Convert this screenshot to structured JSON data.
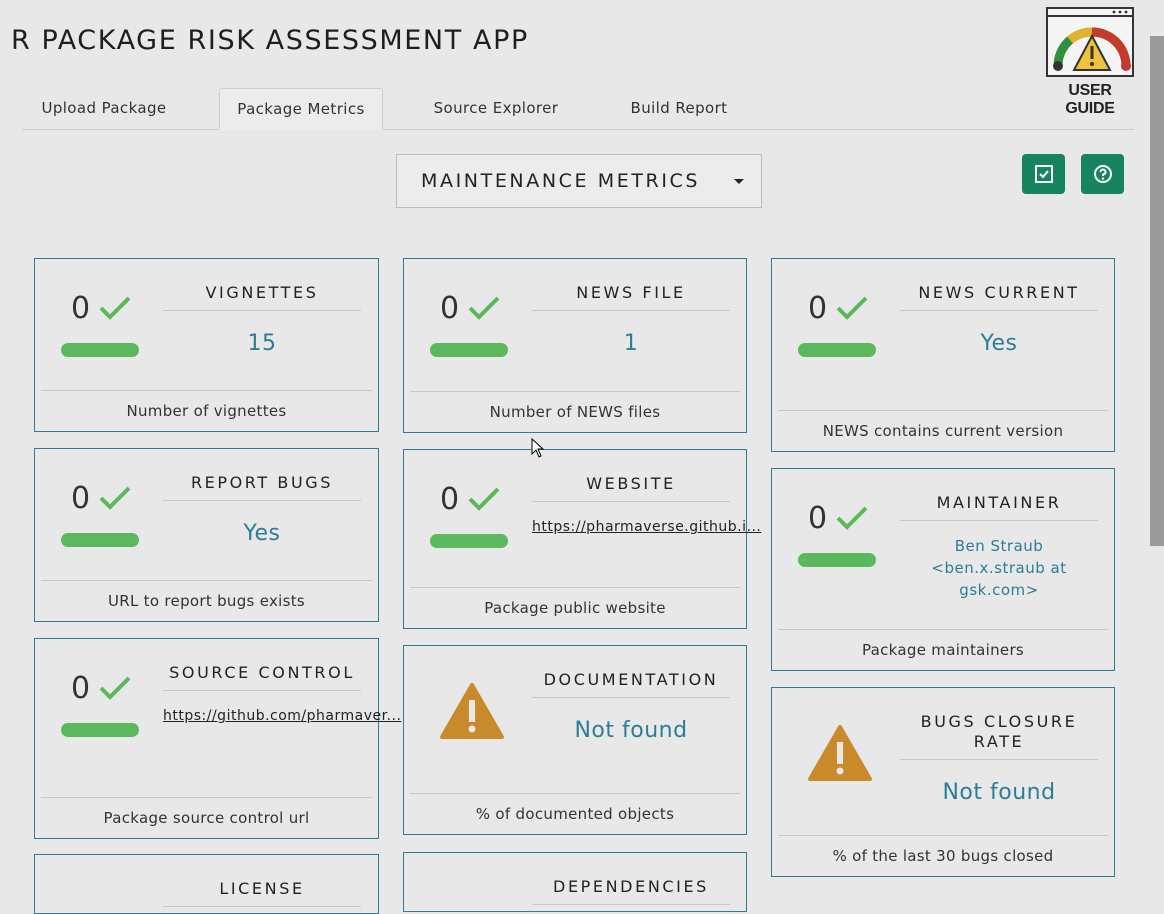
{
  "app": {
    "title": "R PACKAGE RISK ASSESSMENT APP"
  },
  "guide": {
    "label": "USER GUIDE"
  },
  "tabs": [
    {
      "label": "Upload Package"
    },
    {
      "label": "Package Metrics"
    },
    {
      "label": "Source Explorer"
    },
    {
      "label": "Build Report"
    }
  ],
  "toolbar": {
    "metric_category": "MAINTENANCE METRICS"
  },
  "colors": {
    "accent": "#2d7d96",
    "button": "#16855f",
    "bar": "#5cb85c",
    "warning": "#c98a2c"
  },
  "cards": [
    {
      "score": "0",
      "heading": "VIGNETTES",
      "value": "15",
      "footer": "Number of vignettes",
      "status": "check-icon"
    },
    {
      "score": "0",
      "heading": "NEWS FILE",
      "value": "1",
      "footer": "Number of NEWS files",
      "status": "check-icon"
    },
    {
      "score": "0",
      "heading": "NEWS CURRENT",
      "value": "Yes",
      "footer": "NEWS contains current version",
      "status": "check-icon"
    },
    {
      "score": "0",
      "heading": "REPORT BUGS",
      "value": "Yes",
      "footer": "URL to report bugs exists",
      "status": "check-icon"
    },
    {
      "score": "0",
      "heading": "WEBSITE",
      "value": "https://pharmaverse.github.i...",
      "footer": "Package public website",
      "status": "check-icon"
    },
    {
      "score": "0",
      "heading": "MAINTAINER",
      "value": "Ben Straub <ben.x.straub at gsk.com>",
      "footer": "Package maintainers",
      "status": "check-icon"
    },
    {
      "score": "0",
      "heading": "SOURCE CONTROL",
      "value": "https://github.com/pharmaver...",
      "footer": "Package source control url",
      "status": "check-icon"
    },
    {
      "score": "",
      "heading": "DOCUMENTATION",
      "value": "Not found",
      "footer": "% of documented objects",
      "status": "warning-icon"
    },
    {
      "score": "",
      "heading": "BUGS CLOSURE RATE",
      "value": "Not found",
      "footer": "% of the last 30 bugs closed",
      "status": "warning-icon"
    },
    {
      "heading": "LICENSE"
    },
    {
      "heading": "DEPENDENCIES"
    }
  ]
}
